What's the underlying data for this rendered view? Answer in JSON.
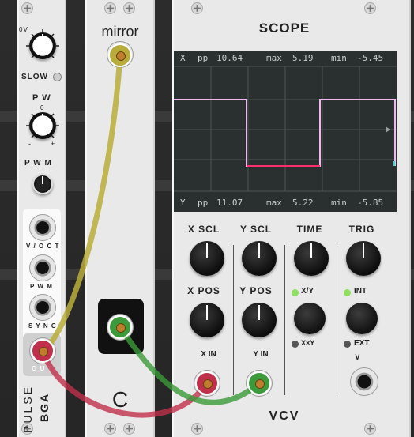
{
  "pulse": {
    "ov_label": "0V",
    "slow_label": "SLOW",
    "pw_label": "P W",
    "pw_zero": "0",
    "pw_minus": "-",
    "pw_plus": "+",
    "pwm_label": "P W M",
    "voct_label": "V / O C T",
    "pwm_in_label": "P W M",
    "sync_label": "S Y N C",
    "out_label": "O U T",
    "title": "PULSE",
    "brand": "BGA"
  },
  "mirror": {
    "title": "mirror",
    "bottom_letter": "C"
  },
  "scope": {
    "title": "SCOPE",
    "x_stats": {
      "channel": "X",
      "pp_label": "pp",
      "pp": "10.64",
      "max_label": "max",
      "max": "5.19",
      "min_label": "min",
      "min": "-5.45"
    },
    "y_stats": {
      "channel": "Y",
      "pp_label": "pp",
      "pp": "11.07",
      "max_label": "max",
      "max": "5.22",
      "min_label": "min",
      "min": "-5.85"
    },
    "x_scl": "X SCL",
    "y_scl": "Y SCL",
    "time": "TIME",
    "trig": "TRIG",
    "x_pos": "X POS",
    "y_pos": "Y POS",
    "xy_label": "X/Y",
    "xxy_label": "X×Y",
    "int_label": "INT",
    "ext_label": "EXT",
    "x_in": "X IN",
    "y_in": "Y IN",
    "logo": "VCV",
    "trig_arrow": "∨"
  },
  "colors": {
    "cable_yellow": "#b8ad3a",
    "cable_red": "#c0304a",
    "cable_green": "#3b9a3a",
    "led_green": "#8fe060",
    "led_off": "#555555",
    "wave_pink": "#f4b6ec",
    "wave_red": "#ff2d6d",
    "wave_cyan": "#3fd6d0"
  }
}
